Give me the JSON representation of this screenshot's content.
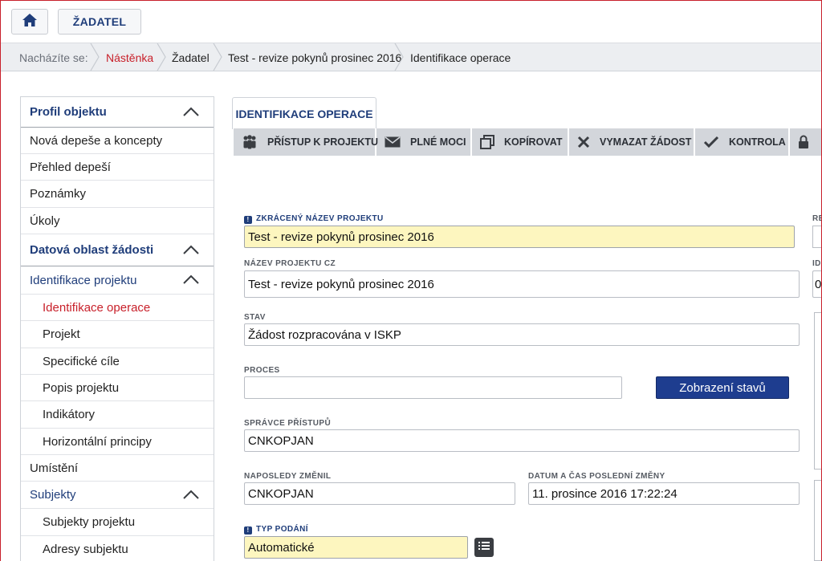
{
  "topbar": {
    "home_icon": "home-icon",
    "zadatel_label": "ŽADATEL"
  },
  "breadcrumb": {
    "prefix": "Nacházíte se:",
    "items": [
      "Nástěnka",
      "Žadatel",
      "Test - revize pokynů prosinec 2016",
      "Identifikace operace"
    ]
  },
  "sidenav": {
    "profil": "Profil objektu",
    "nova_depese": "Nová depeše a koncepty",
    "prehled_depesi": "Přehled depeší",
    "poznamky": "Poznámky",
    "ukoly": "Úkoly",
    "datova_oblast": "Datová oblast žádosti",
    "identifikace_projektu": "Identifikace projektu",
    "identifikace_operace": "Identifikace operace",
    "projekt": "Projekt",
    "specificke_cile": "Specifické cíle",
    "popis_projektu": "Popis projektu",
    "indikatory": "Indikátory",
    "horizontalni_principy": "Horizontální principy",
    "umisteni": "Umístění",
    "subjekty": "Subjekty",
    "subjekty_projektu": "Subjekty projektu",
    "adresy_subjektu": "Adresy subjektu"
  },
  "tab": {
    "label": "IDENTIFIKACE OPERACE"
  },
  "toolbar": {
    "pristup": "PŘÍSTUP K PROJEKTU",
    "plne_moci": "PLNÉ MOCI",
    "kopirovat": "KOPÍROVAT",
    "vymazat": "VYMAZAT ŽÁDOST",
    "kontrola": "KONTROLA"
  },
  "form": {
    "zkraceny_label": "ZKRÁCENÝ NÁZEV PROJEKTU",
    "zkraceny_value": "Test - revize pokynů prosinec 2016",
    "nazev_label": "NÁZEV PROJEKTU CZ",
    "nazev_value": "Test - revize pokynů prosinec 2016",
    "stav_label": "STAV",
    "stav_value": "Žádost rozpracována v ISKP",
    "proces_label": "PROCES",
    "proces_value": "",
    "zobrazeni_button": "Zobrazení stavů",
    "spravce_label": "SPRÁVCE PŘÍSTUPŮ",
    "spravce_value": "CNKOPJAN",
    "naposledy_label": "NAPOSLEDY ZMĚNIL",
    "naposledy_value": "CNKOPJAN",
    "datum_label": "DATUM A ČAS POSLEDNÍ ZMĚNY",
    "datum_value": "11. prosince 2016 17:22:24",
    "typ_label": "TYP PODÁNÍ",
    "typ_value": "Automatické",
    "right_label_1": "RE",
    "right_label_2": "IDI",
    "right_value_2": "0"
  },
  "colors": {
    "brand_blue": "#1f3d7a",
    "active_red": "#c8202a",
    "required_yellow": "#fdf6bf",
    "button_blue": "#1e3d8f",
    "toolbar_gray": "#d3d6db"
  }
}
